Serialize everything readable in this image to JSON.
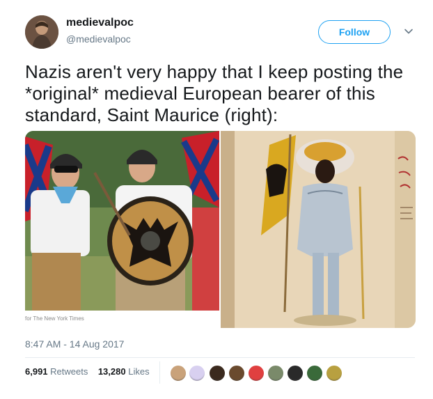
{
  "author": {
    "display_name": "medievalpoc",
    "handle": "@medievalpoc",
    "avatar_icon": "portrait-avatar"
  },
  "follow_button": {
    "label": "Follow",
    "color": "#1da1f2"
  },
  "menu": {
    "icon": "chevron-down-icon"
  },
  "tweet": {
    "text": "Nazis aren't very happy that I keep posting the *original* medieval European bearer of this standard, Saint Maurice (right):"
  },
  "media": {
    "left_caption": "for The New York Times",
    "left_description_icon": "photo-protesters",
    "right_description_icon": "painting-saint-maurice"
  },
  "timestamp": "8:47 AM - 14 Aug 2017",
  "stats": {
    "retweets_count": "6,991",
    "retweets_label": "Retweets",
    "likes_count": "13,280",
    "likes_label": "Likes"
  },
  "likers": [
    {
      "color": "#c9a27a"
    },
    {
      "color": "#d8d0f0"
    },
    {
      "color": "#3b2a1e"
    },
    {
      "color": "#6a4a2e"
    },
    {
      "color": "#e04040"
    },
    {
      "color": "#7a8a6a"
    },
    {
      "color": "#2a2a2a"
    },
    {
      "color": "#3a6a3a"
    },
    {
      "color": "#b8a040"
    }
  ],
  "colors": {
    "text": "#14171a",
    "secondary": "#657786",
    "accent": "#1da1f2",
    "divider": "#e6ecf0"
  }
}
